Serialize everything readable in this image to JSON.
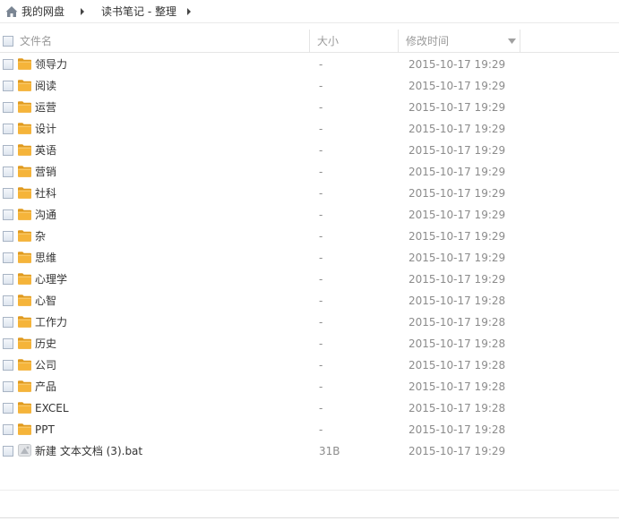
{
  "breadcrumb": {
    "items": [
      {
        "label": "我的网盘"
      },
      {
        "label": "读书笔记 - 整理"
      }
    ]
  },
  "columns": {
    "name": "文件名",
    "size": "大小",
    "modified": "修改时间"
  },
  "files": [
    {
      "name": "领导力",
      "type": "folder",
      "size": "-",
      "modified": "2015-10-17 19:29"
    },
    {
      "name": "阅读",
      "type": "folder",
      "size": "-",
      "modified": "2015-10-17 19:29"
    },
    {
      "name": "运营",
      "type": "folder",
      "size": "-",
      "modified": "2015-10-17 19:29"
    },
    {
      "name": "设计",
      "type": "folder",
      "size": "-",
      "modified": "2015-10-17 19:29"
    },
    {
      "name": "英语",
      "type": "folder",
      "size": "-",
      "modified": "2015-10-17 19:29"
    },
    {
      "name": "营销",
      "type": "folder",
      "size": "-",
      "modified": "2015-10-17 19:29"
    },
    {
      "name": "社科",
      "type": "folder",
      "size": "-",
      "modified": "2015-10-17 19:29"
    },
    {
      "name": "沟通",
      "type": "folder",
      "size": "-",
      "modified": "2015-10-17 19:29"
    },
    {
      "name": "杂",
      "type": "folder",
      "size": "-",
      "modified": "2015-10-17 19:29"
    },
    {
      "name": "思维",
      "type": "folder",
      "size": "-",
      "modified": "2015-10-17 19:29"
    },
    {
      "name": "心理学",
      "type": "folder",
      "size": "-",
      "modified": "2015-10-17 19:29"
    },
    {
      "name": "心智",
      "type": "folder",
      "size": "-",
      "modified": "2015-10-17 19:28"
    },
    {
      "name": "工作力",
      "type": "folder",
      "size": "-",
      "modified": "2015-10-17 19:28"
    },
    {
      "name": "历史",
      "type": "folder",
      "size": "-",
      "modified": "2015-10-17 19:28"
    },
    {
      "name": "公司",
      "type": "folder",
      "size": "-",
      "modified": "2015-10-17 19:28"
    },
    {
      "name": "产品",
      "type": "folder",
      "size": "-",
      "modified": "2015-10-17 19:28"
    },
    {
      "name": "EXCEL",
      "type": "folder",
      "size": "-",
      "modified": "2015-10-17 19:28"
    },
    {
      "name": "PPT",
      "type": "folder",
      "size": "-",
      "modified": "2015-10-17 19:28"
    },
    {
      "name": "新建 文本文档 (3).bat",
      "type": "file",
      "size": "31B",
      "modified": "2015-10-17 19:29"
    }
  ],
  "icons": {
    "home": "home-icon",
    "separator": "chevron-right-icon",
    "sort": "sort-down-icon",
    "folder": "folder-icon",
    "file": "bat-file-icon"
  },
  "colors": {
    "folder": "#f5b43a",
    "muted_text": "#8c8c8c",
    "header_text": "#9a9a9a"
  }
}
